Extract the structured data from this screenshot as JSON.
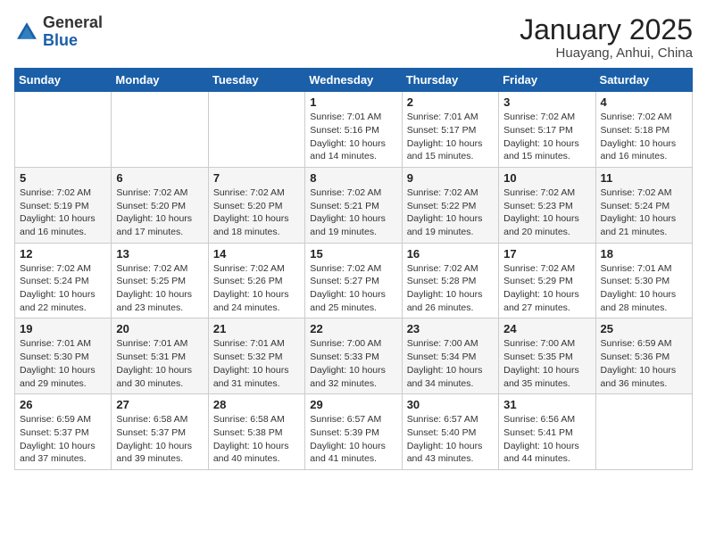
{
  "header": {
    "logo_general": "General",
    "logo_blue": "Blue",
    "month_title": "January 2025",
    "location": "Huayang, Anhui, China"
  },
  "weekdays": [
    "Sunday",
    "Monday",
    "Tuesday",
    "Wednesday",
    "Thursday",
    "Friday",
    "Saturday"
  ],
  "weeks": [
    [
      {
        "day": "",
        "info": ""
      },
      {
        "day": "",
        "info": ""
      },
      {
        "day": "",
        "info": ""
      },
      {
        "day": "1",
        "info": "Sunrise: 7:01 AM\nSunset: 5:16 PM\nDaylight: 10 hours\nand 14 minutes."
      },
      {
        "day": "2",
        "info": "Sunrise: 7:01 AM\nSunset: 5:17 PM\nDaylight: 10 hours\nand 15 minutes."
      },
      {
        "day": "3",
        "info": "Sunrise: 7:02 AM\nSunset: 5:17 PM\nDaylight: 10 hours\nand 15 minutes."
      },
      {
        "day": "4",
        "info": "Sunrise: 7:02 AM\nSunset: 5:18 PM\nDaylight: 10 hours\nand 16 minutes."
      }
    ],
    [
      {
        "day": "5",
        "info": "Sunrise: 7:02 AM\nSunset: 5:19 PM\nDaylight: 10 hours\nand 16 minutes."
      },
      {
        "day": "6",
        "info": "Sunrise: 7:02 AM\nSunset: 5:20 PM\nDaylight: 10 hours\nand 17 minutes."
      },
      {
        "day": "7",
        "info": "Sunrise: 7:02 AM\nSunset: 5:20 PM\nDaylight: 10 hours\nand 18 minutes."
      },
      {
        "day": "8",
        "info": "Sunrise: 7:02 AM\nSunset: 5:21 PM\nDaylight: 10 hours\nand 19 minutes."
      },
      {
        "day": "9",
        "info": "Sunrise: 7:02 AM\nSunset: 5:22 PM\nDaylight: 10 hours\nand 19 minutes."
      },
      {
        "day": "10",
        "info": "Sunrise: 7:02 AM\nSunset: 5:23 PM\nDaylight: 10 hours\nand 20 minutes."
      },
      {
        "day": "11",
        "info": "Sunrise: 7:02 AM\nSunset: 5:24 PM\nDaylight: 10 hours\nand 21 minutes."
      }
    ],
    [
      {
        "day": "12",
        "info": "Sunrise: 7:02 AM\nSunset: 5:24 PM\nDaylight: 10 hours\nand 22 minutes."
      },
      {
        "day": "13",
        "info": "Sunrise: 7:02 AM\nSunset: 5:25 PM\nDaylight: 10 hours\nand 23 minutes."
      },
      {
        "day": "14",
        "info": "Sunrise: 7:02 AM\nSunset: 5:26 PM\nDaylight: 10 hours\nand 24 minutes."
      },
      {
        "day": "15",
        "info": "Sunrise: 7:02 AM\nSunset: 5:27 PM\nDaylight: 10 hours\nand 25 minutes."
      },
      {
        "day": "16",
        "info": "Sunrise: 7:02 AM\nSunset: 5:28 PM\nDaylight: 10 hours\nand 26 minutes."
      },
      {
        "day": "17",
        "info": "Sunrise: 7:02 AM\nSunset: 5:29 PM\nDaylight: 10 hours\nand 27 minutes."
      },
      {
        "day": "18",
        "info": "Sunrise: 7:01 AM\nSunset: 5:30 PM\nDaylight: 10 hours\nand 28 minutes."
      }
    ],
    [
      {
        "day": "19",
        "info": "Sunrise: 7:01 AM\nSunset: 5:30 PM\nDaylight: 10 hours\nand 29 minutes."
      },
      {
        "day": "20",
        "info": "Sunrise: 7:01 AM\nSunset: 5:31 PM\nDaylight: 10 hours\nand 30 minutes."
      },
      {
        "day": "21",
        "info": "Sunrise: 7:01 AM\nSunset: 5:32 PM\nDaylight: 10 hours\nand 31 minutes."
      },
      {
        "day": "22",
        "info": "Sunrise: 7:00 AM\nSunset: 5:33 PM\nDaylight: 10 hours\nand 32 minutes."
      },
      {
        "day": "23",
        "info": "Sunrise: 7:00 AM\nSunset: 5:34 PM\nDaylight: 10 hours\nand 34 minutes."
      },
      {
        "day": "24",
        "info": "Sunrise: 7:00 AM\nSunset: 5:35 PM\nDaylight: 10 hours\nand 35 minutes."
      },
      {
        "day": "25",
        "info": "Sunrise: 6:59 AM\nSunset: 5:36 PM\nDaylight: 10 hours\nand 36 minutes."
      }
    ],
    [
      {
        "day": "26",
        "info": "Sunrise: 6:59 AM\nSunset: 5:37 PM\nDaylight: 10 hours\nand 37 minutes."
      },
      {
        "day": "27",
        "info": "Sunrise: 6:58 AM\nSunset: 5:37 PM\nDaylight: 10 hours\nand 39 minutes."
      },
      {
        "day": "28",
        "info": "Sunrise: 6:58 AM\nSunset: 5:38 PM\nDaylight: 10 hours\nand 40 minutes."
      },
      {
        "day": "29",
        "info": "Sunrise: 6:57 AM\nSunset: 5:39 PM\nDaylight: 10 hours\nand 41 minutes."
      },
      {
        "day": "30",
        "info": "Sunrise: 6:57 AM\nSunset: 5:40 PM\nDaylight: 10 hours\nand 43 minutes."
      },
      {
        "day": "31",
        "info": "Sunrise: 6:56 AM\nSunset: 5:41 PM\nDaylight: 10 hours\nand 44 minutes."
      },
      {
        "day": "",
        "info": ""
      }
    ]
  ]
}
